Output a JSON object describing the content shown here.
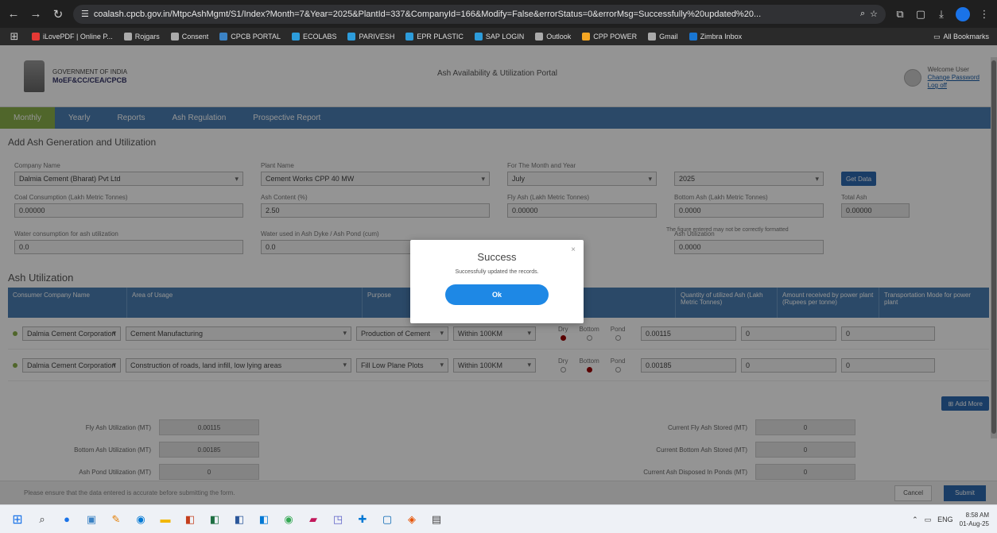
{
  "browser": {
    "url": "coalash.cpcb.gov.in/MtpcAshMgmt/S1/Index?Month=7&Year=2025&PlantId=337&CompanyId=166&Modify=False&errorStatus=0&errorMsg=Successfully%20updated%20...",
    "bookmarks": [
      "iLovePDF | Online P...",
      "Rojgars",
      "Consent",
      "CPCB PORTAL",
      "ECOLABS",
      "PARIVESH",
      "EPR PLASTIC",
      "SAP LOGIN",
      "Outlook",
      "CPP POWER",
      "Gmail",
      "Zimbra Inbox"
    ],
    "all_bookmarks": "All Bookmarks"
  },
  "header": {
    "gov_line1": "GOVERNMENT OF INDIA",
    "gov_line2": "MoEF&CC/CEA/CPCB",
    "portal_title": "Ash Availability & Utilization Portal",
    "user_line": "Welcome User",
    "change_password": "Change Password",
    "logout": "Log off"
  },
  "nav": [
    "Monthly",
    "Yearly",
    "Reports",
    "Ash Regulation",
    "Prospective Report"
  ],
  "page_title": "Add Ash Generation and Utilization",
  "form": {
    "company_label": "Company Name",
    "company_value": "Dalmia Cement (Bharat) Pvt Ltd",
    "plant_label": "Plant Name",
    "plant_value": "Cement Works CPP 40 MW",
    "month_label": "For The Month and Year",
    "month_value": "July",
    "year_value": "2025",
    "go_label": "Get Data",
    "coal_label": "Coal Consumption (Lakh Metric Tonnes)",
    "coal_value": "0.00000",
    "ash_content_label": "Ash Content (%)",
    "ash_content_value": "2.50",
    "fly_ash_label": "Fly Ash (Lakh Metric Tonnes)",
    "fly_ash_value": "0.00000",
    "bottom_ash_label": "Bottom Ash (Lakh Metric Tonnes)",
    "bottom_ash_value": "0.0000",
    "total_label": "Total Ash",
    "total_value": "0.00000",
    "note": "The figure entered may not be correctly formatted",
    "water_label": "Water consumption for ash utilization",
    "water_value": "0.0",
    "water2_label": "Water used in Ash Dyke / Ash Pond (cum)",
    "water2_value": "0.0",
    "ash_util_label": "Ash Utilization",
    "ash_util_value": "0.0000"
  },
  "ash_utilization": {
    "title": "Ash Utilization",
    "columns": [
      "Consumer Company Name",
      "Area of Usage",
      "Purpose",
      "",
      "",
      "Quantity of utilized Ash (Lakh Metric Tonnes)",
      "Amount received by power plant (Rupees per tonne)",
      "Transportation Mode for power plant"
    ],
    "rows": [
      {
        "company": "Dalmia Cement Corporation",
        "area": "Cement Manufacturing",
        "purpose": "Production of Cement",
        "mode": "Within 100KM",
        "r1": "Dry",
        "r2": "Bottom",
        "r3": "Pond",
        "selected": 0,
        "qty": "0.00115",
        "amount": "0",
        "transport": "0"
      },
      {
        "company": "Dalmia Cement Corporation",
        "area": "Construction of roads, land infill, low lying areas",
        "purpose": "Fill Low Plane Plots",
        "mode": "Within 100KM",
        "r1": "Dry",
        "r2": "Bottom",
        "r3": "Pond",
        "selected": 1,
        "qty": "0.00185",
        "amount": "0",
        "transport": "0"
      }
    ],
    "add_more": "Add More"
  },
  "summary": {
    "left": [
      {
        "label": "Fly Ash Utilization (MT)",
        "value": "0.00115"
      },
      {
        "label": "Bottom Ash Utilization (MT)",
        "value": "0.00185"
      },
      {
        "label": "Ash Pond Utilization (MT)",
        "value": "0"
      }
    ],
    "right": [
      {
        "label": "Current Fly Ash Stored (MT)",
        "value": "0"
      },
      {
        "label": "Current Bottom Ash Stored (MT)",
        "value": "0"
      },
      {
        "label": "Current Ash Disposed In Ponds (MT)",
        "value": "0"
      }
    ]
  },
  "footer": {
    "text": "Please ensure that the data entered is accurate before submitting the form.",
    "cancel": "Cancel",
    "submit": "Submit"
  },
  "modal": {
    "title": "Success",
    "message": "Successfully updated the records.",
    "ok": "Ok",
    "close": "×"
  },
  "tray": {
    "lang": "ENG",
    "time": "8:58 AM",
    "date": "01-Aug-25"
  }
}
